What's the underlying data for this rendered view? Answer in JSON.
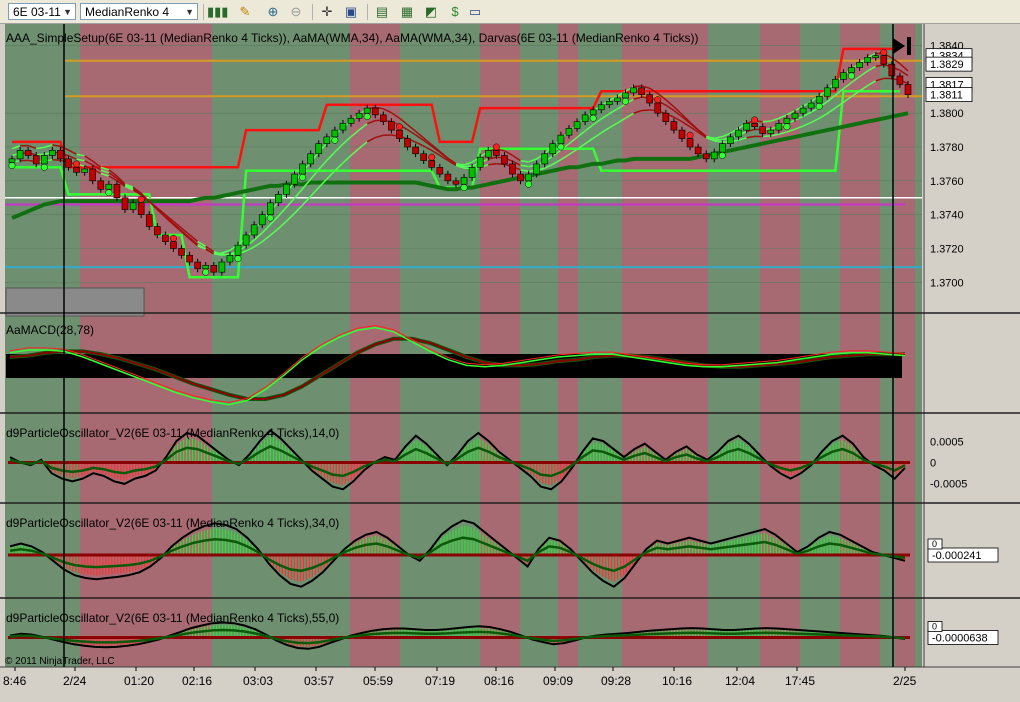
{
  "toolbar": {
    "instrument": "6E 03-11",
    "chart_type": "MedianRenko 4 Ticks",
    "icons": [
      "bar-style-icon",
      "draw-icon",
      "zoom-in-icon",
      "zoom-out-icon",
      "crosshair-icon",
      "display-icon",
      "data-box-icon",
      "indicators-icon",
      "strategies-icon",
      "properties-icon"
    ]
  },
  "colors": {
    "bg": "#6e9070",
    "bull_band": "#6e9070",
    "bear_band": "#a86a72",
    "bull": "#00c000",
    "bear": "#c00000",
    "lime": "#33ff33",
    "darkgreen": "#006400",
    "darkred": "#8b0000",
    "orange": "#d49a22",
    "magenta": "#cc33cc",
    "cyan": "#33aacc"
  },
  "chart_data": [
    {
      "panel": "price",
      "type": "candlestick",
      "title": "AAA_SimpleSetup(6E 03-11 (MedianRenko 4 Ticks)), AaMA(WMA,34), AaMA(WMA,34), Darvas(6E 03-11 (MedianRenko 4 Ticks))",
      "ylim": [
        1.3686,
        1.3848
      ],
      "y_ticks": [
        "1.3840",
        "1.3800",
        "1.3780",
        "1.3760",
        "1.3740",
        "1.3720",
        "1.3700"
      ],
      "price_labels": [
        "1.3834",
        "1.3829",
        "1.3817",
        "1.3811"
      ],
      "close_series": [
        1.3773,
        1.3778,
        1.3775,
        1.377,
        1.3775,
        1.3778,
        1.3773,
        1.3768,
        1.3765,
        1.3767,
        1.376,
        1.3755,
        1.3758,
        1.375,
        1.3743,
        1.3747,
        1.374,
        1.3733,
        1.3728,
        1.3724,
        1.372,
        1.3716,
        1.3712,
        1.3708,
        1.371,
        1.3706,
        1.3712,
        1.3716,
        1.3722,
        1.3728,
        1.3734,
        1.374,
        1.3747,
        1.3752,
        1.3758,
        1.3764,
        1.377,
        1.3776,
        1.3782,
        1.3786,
        1.379,
        1.3794,
        1.3797,
        1.38,
        1.3803,
        1.3799,
        1.3795,
        1.379,
        1.3785,
        1.378,
        1.3776,
        1.3772,
        1.3768,
        1.3764,
        1.376,
        1.3758,
        1.3762,
        1.3768,
        1.3774,
        1.3778,
        1.3775,
        1.377,
        1.3764,
        1.376,
        1.3764,
        1.377,
        1.3776,
        1.3782,
        1.3787,
        1.3791,
        1.3795,
        1.3799,
        1.3802,
        1.3805,
        1.3807,
        1.3809,
        1.3812,
        1.3815,
        1.3811,
        1.3806,
        1.38,
        1.3795,
        1.379,
        1.3785,
        1.378,
        1.3776,
        1.3773,
        1.3777,
        1.3782,
        1.3786,
        1.379,
        1.3794,
        1.3792,
        1.3788,
        1.379,
        1.3794,
        1.3797,
        1.38,
        1.3803,
        1.3806,
        1.381,
        1.3815,
        1.382,
        1.3824,
        1.3827,
        1.383,
        1.3833,
        1.3834,
        1.3829,
        1.3822,
        1.3817,
        1.3811
      ],
      "darvas_top": [
        1.3783,
        1.3783,
        1.3783,
        1.3783,
        1.3783,
        1.3783,
        1.3783,
        1.3768,
        1.3768,
        1.3768,
        1.3768,
        1.3768,
        1.3768,
        1.3768,
        1.3768,
        1.3768,
        1.3768,
        1.3768,
        1.3768,
        1.3768,
        1.3768,
        1.3768,
        1.3768,
        1.3768,
        1.3768,
        1.3768,
        1.3768,
        1.3768,
        1.3768,
        1.379,
        1.379,
        1.379,
        1.379,
        1.379,
        1.379,
        1.379,
        1.379,
        1.379,
        1.379,
        1.3805,
        1.3805,
        1.3805,
        1.3805,
        1.3805,
        1.3805,
        1.3805,
        1.3805,
        1.3805,
        1.3805,
        1.3805,
        1.3805,
        1.3805,
        1.3805,
        1.3783,
        1.3783,
        1.3783,
        1.3783,
        1.3783,
        1.3803,
        1.3803,
        1.3803,
        1.3803,
        1.3803,
        1.3803,
        1.3803,
        1.3803,
        1.3803,
        1.3803,
        1.3803,
        1.3803,
        1.3803,
        1.3803,
        1.3803,
        1.3813,
        1.3813,
        1.3813,
        1.3813,
        1.3813,
        1.3813,
        1.3813,
        1.3813,
        1.3813,
        1.3813,
        1.3813,
        1.3813,
        1.3813,
        1.3813,
        1.3813,
        1.3813,
        1.3813,
        1.3813,
        1.3813,
        1.3813,
        1.3813,
        1.3813,
        1.3813,
        1.3813,
        1.3813,
        1.3813,
        1.3813,
        1.3813,
        1.3813,
        1.3813,
        1.3838,
        1.3838,
        1.3838,
        1.3838,
        1.3838,
        1.3838,
        1.3838,
        1.3838
      ],
      "darvas_bottom": [
        1.3768,
        1.3768,
        1.3768,
        1.3768,
        1.3768,
        1.3768,
        1.3768,
        1.3752,
        1.3752,
        1.3752,
        1.3752,
        1.3752,
        1.3752,
        1.3752,
        1.3752,
        1.3752,
        1.3752,
        1.3752,
        1.3728,
        1.3728,
        1.3728,
        1.3728,
        1.3703,
        1.3703,
        1.3703,
        1.3703,
        1.3703,
        1.3703,
        1.3703,
        1.3766,
        1.3766,
        1.3766,
        1.3766,
        1.3766,
        1.3766,
        1.3766,
        1.3766,
        1.3766,
        1.3766,
        1.3766,
        1.3766,
        1.3766,
        1.3766,
        1.3766,
        1.3766,
        1.3766,
        1.3766,
        1.3766,
        1.3766,
        1.3766,
        1.3766,
        1.3766,
        1.3766,
        1.3756,
        1.3756,
        1.3756,
        1.3756,
        1.3756,
        1.3779,
        1.3779,
        1.3779,
        1.3779,
        1.3779,
        1.3779,
        1.3779,
        1.3779,
        1.3779,
        1.3779,
        1.3779,
        1.3779,
        1.3779,
        1.3779,
        1.3779,
        1.3766,
        1.3766,
        1.3766,
        1.3766,
        1.3766,
        1.3766,
        1.3766,
        1.3766,
        1.3766,
        1.3766,
        1.3766,
        1.3766,
        1.3766,
        1.3766,
        1.3766,
        1.3766,
        1.3766,
        1.3766,
        1.3766,
        1.3766,
        1.3766,
        1.3766,
        1.3766,
        1.3766,
        1.3766,
        1.3766,
        1.3766,
        1.3766,
        1.3766,
        1.3766,
        1.3813,
        1.3813,
        1.3813,
        1.3813,
        1.3813,
        1.3813,
        1.3813,
        1.3813
      ],
      "slow_ma": [
        1.3738,
        1.374,
        1.3742,
        1.3744,
        1.3746,
        1.3747,
        1.3748,
        1.3748,
        1.3748,
        1.3748,
        1.3748,
        1.3748,
        1.3748,
        1.3748,
        1.3748,
        1.3748,
        1.3748,
        1.3748,
        1.3748,
        1.3748,
        1.3748,
        1.3748,
        1.3748,
        1.3749,
        1.375,
        1.375,
        1.3751,
        1.3752,
        1.3753,
        1.3754,
        1.3755,
        1.3756,
        1.3757,
        1.3757,
        1.3758,
        1.3758,
        1.3758,
        1.3759,
        1.3759,
        1.3759,
        1.3759,
        1.3759,
        1.3759,
        1.3759,
        1.3759,
        1.3759,
        1.3759,
        1.3759,
        1.3759,
        1.3759,
        1.3759,
        1.3758,
        1.3757,
        1.3756,
        1.3755,
        1.3755,
        1.3756,
        1.3756,
        1.3757,
        1.3758,
        1.3759,
        1.376,
        1.3761,
        1.3762,
        1.3763,
        1.3764,
        1.3765,
        1.3766,
        1.3767,
        1.3768,
        1.3768,
        1.3769,
        1.377,
        1.377,
        1.3771,
        1.3772,
        1.3772,
        1.3773,
        1.3773,
        1.3773,
        1.3773,
        1.3773,
        1.3773,
        1.3773,
        1.3773,
        1.3774,
        1.3775,
        1.3776,
        1.3777,
        1.3778,
        1.3779,
        1.378,
        1.3781,
        1.3782,
        1.3783,
        1.3784,
        1.3785,
        1.3786,
        1.3787,
        1.3788,
        1.3789,
        1.379,
        1.3791,
        1.3792,
        1.3793,
        1.3794,
        1.3795,
        1.3796,
        1.3797,
        1.3798,
        1.3799,
        1.38
      ],
      "hlines": [
        {
          "y": 1.375,
          "color": "white"
        },
        {
          "y": 1.3746,
          "color": "magenta"
        },
        {
          "y": 1.3709,
          "color": "cyan"
        },
        {
          "y": 1.3831,
          "color": "orange"
        },
        {
          "y": 1.381,
          "color": "orange"
        }
      ],
      "x_labels": [
        "8:46",
        "2/24",
        "01:20",
        "02:16",
        "03:03",
        "03:57",
        "05:59",
        "07:19",
        "08:16",
        "09:09",
        "09:28",
        "10:16",
        "12:04",
        "17:45",
        "2/25"
      ]
    },
    {
      "panel": "macd",
      "type": "line",
      "title": "AaMACD(28,78)",
      "macd": [
        0.8,
        1.0,
        1.0,
        0.9,
        0.5,
        0.0,
        -0.5,
        -1.0,
        -1.5,
        -2.0,
        -2.4,
        -2.7,
        -2.9,
        -2.6,
        -1.8,
        -0.8,
        0.3,
        1.2,
        1.9,
        2.4,
        2.6,
        2.3,
        1.6,
        0.9,
        0.3,
        -0.1,
        -0.2,
        -0.1,
        0.1,
        0.3,
        0.5,
        0.6,
        0.7,
        0.7,
        0.5,
        0.3,
        0.1,
        -0.1,
        -0.2,
        -0.2,
        -0.1,
        0.0,
        0.1,
        0.3,
        0.5,
        0.7,
        0.8,
        0.8,
        0.7,
        0.6
      ],
      "signal": [
        0.5,
        0.6,
        0.8,
        0.9,
        0.9,
        0.7,
        0.4,
        0.0,
        -0.4,
        -0.9,
        -1.4,
        -1.8,
        -2.2,
        -2.5,
        -2.5,
        -2.2,
        -1.6,
        -0.8,
        0.0,
        0.8,
        1.4,
        1.8,
        1.8,
        1.5,
        1.0,
        0.5,
        0.1,
        -0.1,
        -0.1,
        0.0,
        0.2,
        0.3,
        0.5,
        0.6,
        0.6,
        0.5,
        0.3,
        0.1,
        -0.1,
        -0.2,
        -0.2,
        -0.1,
        0.0,
        0.1,
        0.3,
        0.5,
        0.6,
        0.7,
        0.7,
        0.7
      ]
    },
    {
      "panel": "osc1",
      "type": "histogram",
      "title": "d9ParticleOscillator_V2(6E 03-11 (MedianRenko 4 Ticks),14,0)",
      "y_ticks": [
        "0.0005",
        "0",
        "-0.0005"
      ],
      "values": [
        0.1,
        0.0,
        -0.05,
        0.05,
        -0.2,
        -0.3,
        -0.35,
        -0.3,
        -0.2,
        -0.25,
        -0.35,
        -0.4,
        -0.3,
        -0.25,
        -0.15,
        0.1,
        0.4,
        0.55,
        0.5,
        0.35,
        0.2,
        0.05,
        -0.05,
        0.15,
        0.4,
        0.6,
        0.45,
        0.25,
        0.05,
        -0.15,
        -0.3,
        -0.45,
        -0.5,
        -0.35,
        -0.15,
        0.0,
        0.1,
        0.05,
        0.3,
        0.5,
        0.35,
        0.15,
        -0.05,
        0.15,
        0.4,
        0.55,
        0.4,
        0.2,
        0.05,
        -0.1,
        -0.25,
        -0.45,
        -0.5,
        -0.35,
        -0.1,
        0.2,
        0.45,
        0.4,
        0.25,
        0.1,
        0.25,
        0.35,
        0.2,
        0.05,
        0.2,
        0.3,
        0.15,
        0.05,
        0.2,
        0.4,
        0.5,
        0.35,
        0.15,
        -0.05,
        -0.2,
        -0.3,
        -0.2,
        -0.05,
        0.2,
        0.4,
        0.5,
        0.35,
        0.1,
        -0.05,
        -0.15,
        -0.3,
        -0.1
      ],
      "range": [
        -0.0007,
        0.0007
      ]
    },
    {
      "panel": "osc2",
      "type": "histogram",
      "title": "d9ParticleOscillator_V2(6E 03-11 (MedianRenko 4 Ticks),34,0)",
      "value_label": "-0.000241",
      "values": [
        0.15,
        0.2,
        0.15,
        0.05,
        -0.1,
        -0.25,
        -0.35,
        -0.4,
        -0.42,
        -0.4,
        -0.38,
        -0.35,
        -0.3,
        -0.2,
        -0.05,
        0.15,
        0.3,
        0.42,
        0.5,
        0.55,
        0.52,
        0.45,
        0.3,
        0.1,
        -0.15,
        -0.35,
        -0.5,
        -0.55,
        -0.45,
        -0.3,
        -0.1,
        0.1,
        0.25,
        0.35,
        0.4,
        0.3,
        0.15,
        0.0,
        -0.1,
        0.1,
        0.35,
        0.5,
        0.6,
        0.55,
        0.4,
        0.25,
        0.1,
        -0.05,
        -0.2,
        0.1,
        0.3,
        0.25,
        0.1,
        -0.1,
        -0.3,
        -0.45,
        -0.55,
        -0.4,
        -0.15,
        0.1,
        0.25,
        0.2,
        0.25,
        0.3,
        0.25,
        0.2,
        0.25,
        0.3,
        0.35,
        0.4,
        0.45,
        0.35,
        0.2,
        0.05,
        0.15,
        0.3,
        0.4,
        0.35,
        0.25,
        0.15,
        0.05,
        0.0,
        -0.05,
        -0.1
      ],
      "range": [
        -0.0007,
        0.0007
      ]
    },
    {
      "panel": "osc3",
      "type": "histogram",
      "title": "d9ParticleOscillator_V2(6E 03-11 (MedianRenko 4 Ticks),55,0)",
      "value_label": "-0.0000638",
      "values": [
        0.05,
        0.1,
        0.08,
        0.02,
        -0.05,
        -0.12,
        -0.18,
        -0.22,
        -0.25,
        -0.26,
        -0.25,
        -0.22,
        -0.18,
        -0.12,
        -0.05,
        0.05,
        0.15,
        0.25,
        0.32,
        0.38,
        0.4,
        0.38,
        0.32,
        0.22,
        0.08,
        -0.08,
        -0.2,
        -0.28,
        -0.3,
        -0.25,
        -0.15,
        -0.05,
        0.05,
        0.12,
        0.18,
        0.22,
        0.24,
        0.24,
        0.22,
        0.2,
        0.2,
        0.22,
        0.25,
        0.28,
        0.3,
        0.28,
        0.22,
        0.15,
        0.05,
        -0.05,
        -0.12,
        -0.18,
        -0.15,
        -0.08,
        0.0,
        0.05,
        0.08,
        0.1,
        0.12,
        0.15,
        0.18,
        0.2,
        0.22,
        0.24,
        0.25,
        0.24,
        0.22,
        0.2,
        0.2,
        0.22,
        0.24,
        0.25,
        0.24,
        0.22,
        0.2,
        0.18,
        0.16,
        0.14,
        0.12,
        0.1,
        0.08,
        0.06,
        0.04,
        0.0,
        -0.04
      ],
      "range": [
        -0.0005,
        0.0005
      ]
    }
  ],
  "copyright": "© 2011 NinjaTrader, LLC"
}
